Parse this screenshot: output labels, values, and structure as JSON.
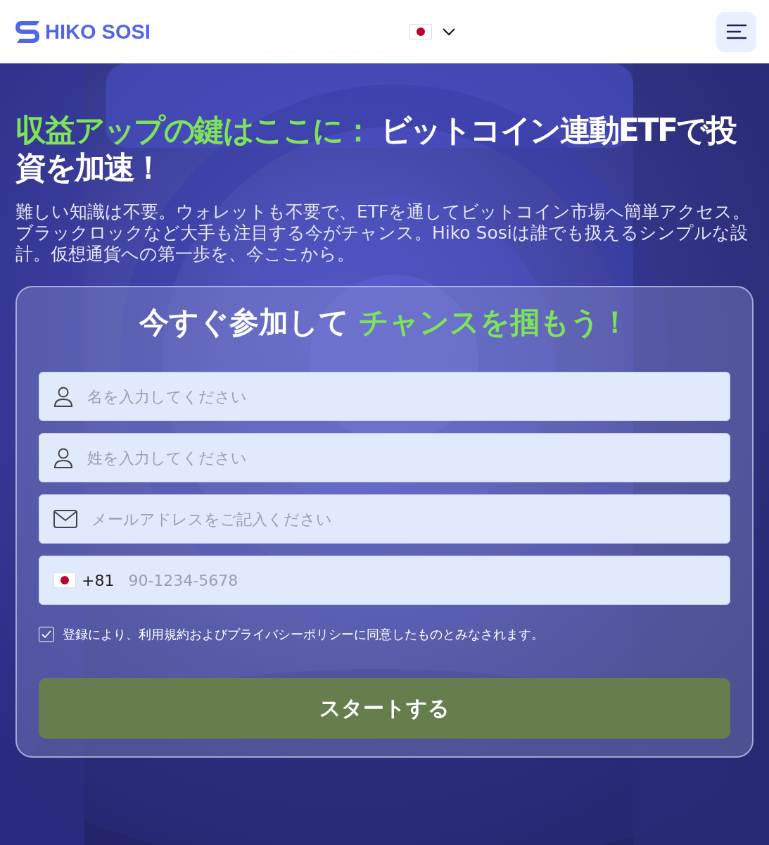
{
  "header": {
    "logo": "HIKO SOSI"
  },
  "hero": {
    "headline_highlight": "収益アップの鍵はここに：",
    "headline_rest": "ビットコイン連動ETFで投資を加速！",
    "description": "難しい知識は不要。ウォレットも不要で、ETFを通してビットコイン市場へ簡単アクセス。ブラックロックなど大手も注目する今がチャンス。Hiko Sosiは誰でも扱えるシンプルな設計。仮想通貨への第一歩を、今ここから。"
  },
  "form": {
    "title_plain": "今すぐ参加して",
    "title_highlight": "チャンスを掴もう！",
    "fields": [
      {
        "kind": "person",
        "placeholder": "名を入力してください"
      },
      {
        "kind": "person",
        "placeholder": "姓を入力してください"
      },
      {
        "kind": "email",
        "placeholder": "メールアドレスをご記入ください"
      },
      {
        "kind": "phone",
        "code": "+81",
        "placeholder": "90-1234-5678"
      }
    ],
    "consent": {
      "checked": true,
      "text": "登録により、利用規約およびプライバシーポリシーに同意したものとみなされます。"
    },
    "submit": "スタートする"
  }
}
